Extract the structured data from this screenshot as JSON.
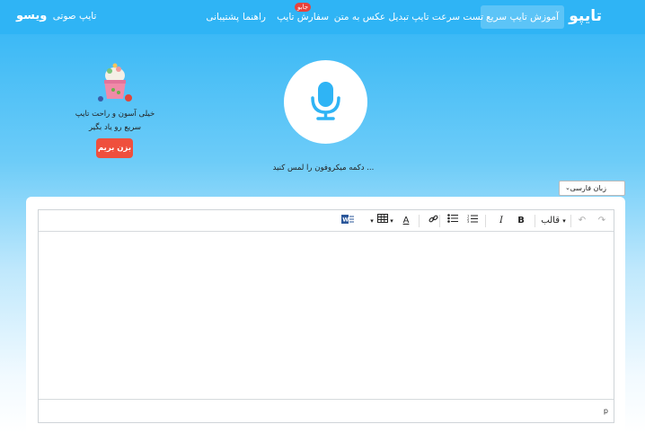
{
  "nav": {
    "logo": "تایپو",
    "items": [
      {
        "label": "آموزش تایپ سریع"
      },
      {
        "label": "تست سرعت تایپ"
      },
      {
        "label": "تبدیل عکس به متن"
      },
      {
        "label": "سفارش تایپ",
        "badge": "جابو"
      },
      {
        "label": "راهنما"
      },
      {
        "label": "پشتیبانی"
      }
    ],
    "voice_brand_bold": "ویسو",
    "voice_brand_text": "تایپ صوتی"
  },
  "mic": {
    "icon": "microphone-icon",
    "hint": "دکمه میکروفون را لمس کنید ..."
  },
  "promo": {
    "line1": "خیلی آسون و راحت تایپ",
    "line2": "سریع رو یاد بگیر",
    "button": "بزن بریم"
  },
  "language": {
    "selected": "زبان فارسی"
  },
  "toolbar": {
    "format_label": "قالب",
    "bold": "B",
    "italic": "I",
    "font_color": "A",
    "word": "W"
  },
  "statusbar": {
    "path": "p"
  },
  "colors": {
    "accent": "#2fb4f5",
    "button_red": "#ef4f3d",
    "badge_red": "#e8423c"
  }
}
